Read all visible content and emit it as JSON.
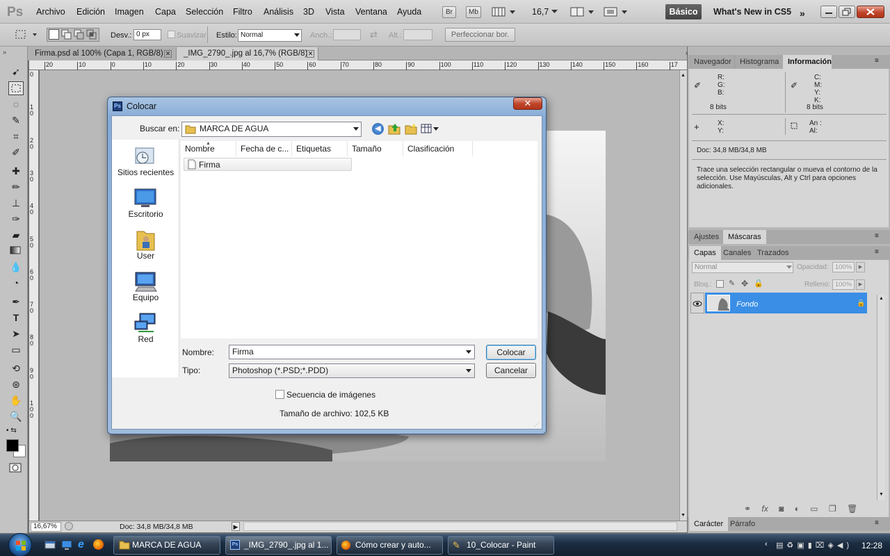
{
  "app": {
    "logo": "Ps",
    "menu": [
      "Archivo",
      "Edición",
      "Imagen",
      "Capa",
      "Selección",
      "Filtro",
      "Análisis",
      "3D",
      "Vista",
      "Ventana",
      "Ayuda"
    ],
    "bar_buttons": {
      "br": "Br",
      "mb": "Mb"
    },
    "zoom": "16,7",
    "workspace": "Básico",
    "whats_new": "What's New in CS5"
  },
  "options": {
    "desv_label": "Desv.:",
    "desv_value": "0 px",
    "suavizar": "Suavizar",
    "estilo_label": "Estilo:",
    "estilo_value": "Normal",
    "anch_label": "Anch.:",
    "alt_label": "Alt.:",
    "perfeccionar": "Perfeccionar bor."
  },
  "tabs": [
    {
      "label": "Firma.psd al 100% (Capa 1, RGB/8)"
    },
    {
      "label": "_IMG_2790_.jpg al 16,7% (RGB/8)"
    }
  ],
  "ruler": {
    "h": [
      "20",
      "10",
      "0",
      "10",
      "20",
      "30",
      "40",
      "50",
      "60",
      "70",
      "80",
      "90",
      "100",
      "110",
      "120",
      "130",
      "140",
      "150",
      "160",
      "17"
    ],
    "v": [
      "0",
      "1 0",
      "2 0",
      "3 0",
      "4 0",
      "5 0",
      "6 0",
      "7 0",
      "8 0",
      "9 0",
      "1 0 0"
    ]
  },
  "status": {
    "zoom": "16,67%",
    "doc": "Doc: 34,8 MB/34,8 MB"
  },
  "panels": {
    "top_tabs": [
      "Navegador",
      "Histograma",
      "Información"
    ],
    "rgb": [
      "R:",
      "G:",
      "B:"
    ],
    "cmyk": [
      "C:",
      "M:",
      "Y:",
      "K:"
    ],
    "bits_left": "8 bits",
    "bits_right": "8 bits",
    "xy": [
      "X:",
      "Y:"
    ],
    "wh": [
      "An :",
      "Al:"
    ],
    "doc": "Doc: 34,8 MB/34,8 MB",
    "hint": "Trace una selección rectangular o mueva el contorno de la selección. Use Mayúsculas, Alt y Ctrl para opciones adicionales.",
    "mid_tabs": [
      "Ajustes",
      "Máscaras"
    ],
    "layer_tabs": [
      "Capas",
      "Canales",
      "Trazados"
    ],
    "blend": "Normal",
    "opacity_label": "Opacidad:",
    "opacity": "100%",
    "lock_label": "Bloq.:",
    "fill_label": "Relleno:",
    "fill": "100%",
    "layer_name": "Fondo",
    "bottom_tabs": [
      "Carácter",
      "Párrafo"
    ]
  },
  "dialog": {
    "title": "Colocar",
    "look_in_label": "Buscar en:",
    "look_in_value": "MARCA DE AGUA",
    "places": [
      "Sitios recientes",
      "Escritorio",
      "User",
      "Equipo",
      "Red"
    ],
    "columns": [
      "Nombre",
      "Fecha de c...",
      "Etiquetas",
      "Tamaño",
      "Clasificación"
    ],
    "files": [
      "Firma"
    ],
    "name_label": "Nombre:",
    "name_value": "Firma",
    "type_label": "Tipo:",
    "type_value": "Photoshop (*.PSD;*.PDD)",
    "place_button": "Colocar",
    "cancel_button": "Cancelar",
    "sequence_label": "Secuencia de imágenes",
    "file_size": "Tamaño de archivo: 102,5 KB"
  },
  "taskbar": {
    "items": [
      "MARCA DE AGUA",
      "_IMG_2790_.jpg al 1...",
      "Cómo crear y auto...",
      "10_Colocar - Paint"
    ],
    "clock": "12:28"
  },
  "colors": {
    "selection_blue": "#3a8ee6",
    "close_red": "#c0462c",
    "taskbar": "#1c2d42"
  }
}
